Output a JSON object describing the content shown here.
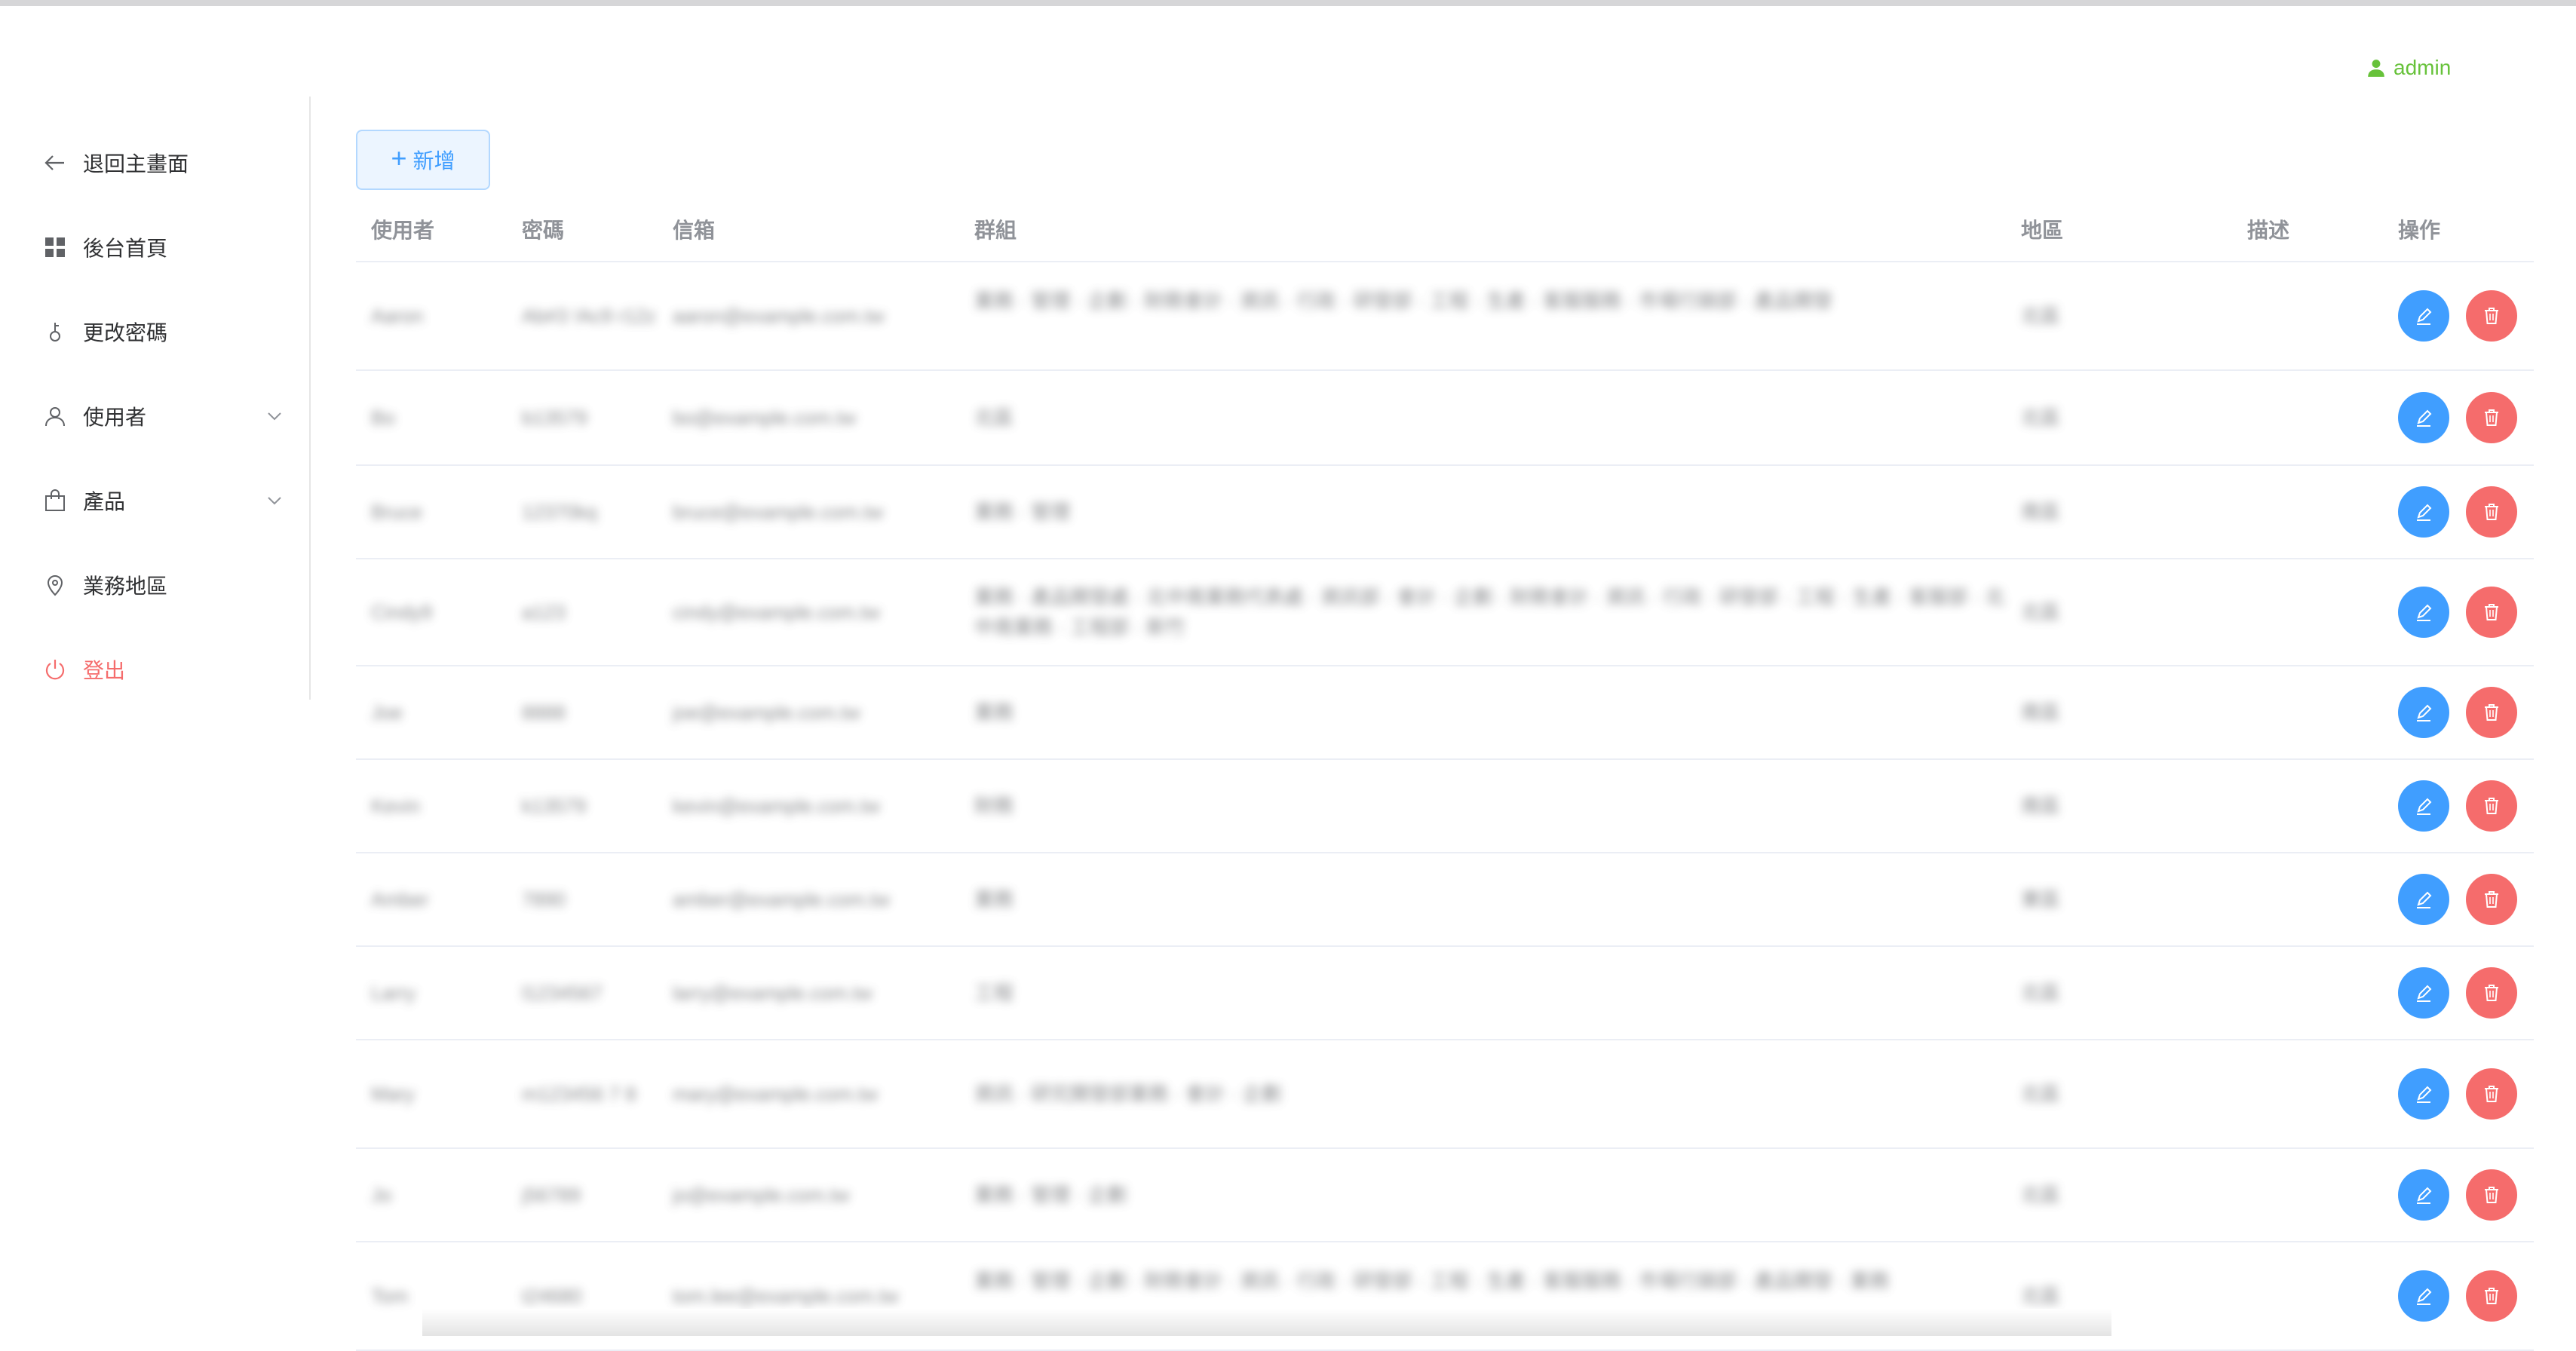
{
  "header": {
    "username": "admin"
  },
  "sidebar": {
    "items": [
      {
        "label": "退回主畫面",
        "icon": "arrow-left-icon"
      },
      {
        "label": "後台首頁",
        "icon": "dashboard-grid-icon"
      },
      {
        "label": "更改密碼",
        "icon": "key-icon"
      },
      {
        "label": "使用者",
        "icon": "user-icon"
      },
      {
        "label": "產品",
        "icon": "shopping-bag-icon"
      },
      {
        "label": "業務地區",
        "icon": "location-pin-icon"
      },
      {
        "label": "登出",
        "icon": "power-icon"
      }
    ]
  },
  "toolbar": {
    "add_label": "新增"
  },
  "table": {
    "columns": [
      "使用者",
      "密碼",
      "信箱",
      "群組",
      "地區",
      "描述",
      "操作"
    ],
    "rows": [
      {
        "user": "Aaron",
        "password": "Ab#3 !Ac9 r12z",
        "email": "aaron@example.com.tw",
        "group": "業務 · 管理 · 企劃 · 財務會計 · 資訊 · 行政 · 研發部 · 工程 · 生產 · 客服服務 · 市場行銷部 · 產品開發",
        "region": "北區",
        "desc": ""
      },
      {
        "user": "Bo",
        "password": "b13579",
        "email": "bo@example.com.tw",
        "group": "北區",
        "region": "北區",
        "desc": ""
      },
      {
        "user": "Bruce",
        "password": "12370kq",
        "email": "bruce@example.com.tw",
        "group": "業務 · 管理",
        "region": "南區",
        "desc": ""
      },
      {
        "user": "Cindy9",
        "password": "a123",
        "email": "cindy@example.com.tw",
        "group": "業務 · 產品開發處 · 北中南業務代表處 · 資訊部 · 會計 · 企劃 · 財務會計 · 資訊 · 行政 · 研發部 · 工程 · 生產 · 客服部 · 北中南業務 · 工程部 · 新竹",
        "region": "北區",
        "desc": ""
      },
      {
        "user": "Joe",
        "password": "8888",
        "email": "joe@example.com.tw",
        "group": "業務",
        "region": "南區",
        "desc": ""
      },
      {
        "user": "Kevin",
        "password": "k13579",
        "email": "kevin@example.com.tw",
        "group": "財務",
        "region": "南區",
        "desc": ""
      },
      {
        "user": "Amber",
        "password": "7890",
        "email": "amber@example.com.tw",
        "group": "業務",
        "region": "東區",
        "desc": ""
      },
      {
        "user": "Larry",
        "password": "l1234567",
        "email": "larry@example.com.tw",
        "group": "工程",
        "region": "北區",
        "desc": ""
      },
      {
        "user": "Mary",
        "password": "m123456 7 8",
        "email": "mary@example.com.tw",
        "group": "資訊 · 研究開發部業務 · 會計 · 企劃",
        "region": "北區",
        "desc": ""
      },
      {
        "user": "Jo",
        "password": "j56789",
        "email": "jo@example.com.tw",
        "group": "業務 · 管理 · 企劃",
        "region": "北區",
        "desc": ""
      },
      {
        "user": "Tom",
        "password": "t24680",
        "email": "tom.lee@example.com.tw",
        "group": "業務 · 管理 · 企劃 · 財務會計 · 資訊 · 行政 · 研發部 · 工程 · 生產 · 客服服務 · 市場行銷部 · 產品開發 · 業務",
        "region": "北區",
        "desc": ""
      }
    ]
  },
  "colors": {
    "primary": "#409eff",
    "danger": "#f56c6c",
    "success": "#67c23a"
  }
}
